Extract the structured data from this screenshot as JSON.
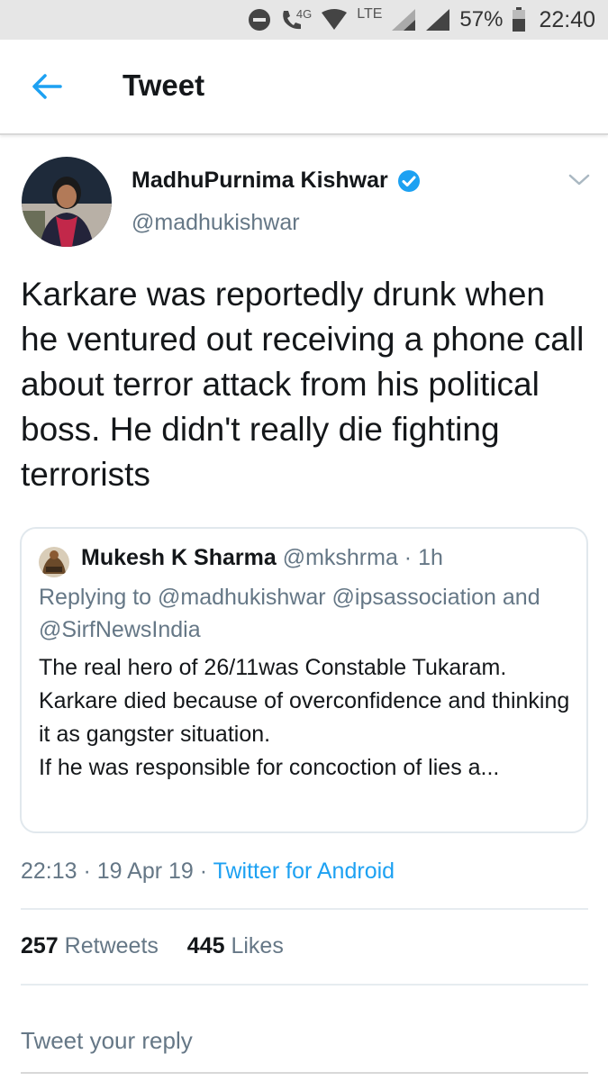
{
  "status_bar": {
    "network_small": "4G",
    "lte": "LTE",
    "battery": "57%",
    "time": "22:40"
  },
  "header": {
    "back_icon": "back-arrow-icon",
    "title": "Tweet"
  },
  "tweet": {
    "author_name": "MadhuPurnima Kishwar",
    "author_handle": "@madhukishwar",
    "verified": true,
    "text": "Karkare was reportedly drunk when he ventured out receiving a phone call about terror attack from his political boss. He didn't really die fighting terrorists",
    "quoted": {
      "author_name": "Mukesh K Sharma",
      "author_meta": "@mkshrma · 1h",
      "replying_to": "Replying to @madhukishwar @ipsassociation and @SirfNewsIndia",
      "text_lines": [
        "The real hero of 26/11was Constable Tukaram.",
        "Karkare died because of overconfidence and thinking it as gangster situation.",
        "If he was responsible for concoction of lies a..."
      ]
    },
    "timestamp": "22:13 · 19 Apr 19 · ",
    "source": "Twitter for Android",
    "retweets_count": "257",
    "retweets_label": "Retweets",
    "likes_count": "445",
    "likes_label": "Likes"
  },
  "reply": {
    "placeholder": "Tweet your reply"
  },
  "colors": {
    "accent": "#1da1f2",
    "muted": "#657786",
    "text": "#14171a"
  }
}
